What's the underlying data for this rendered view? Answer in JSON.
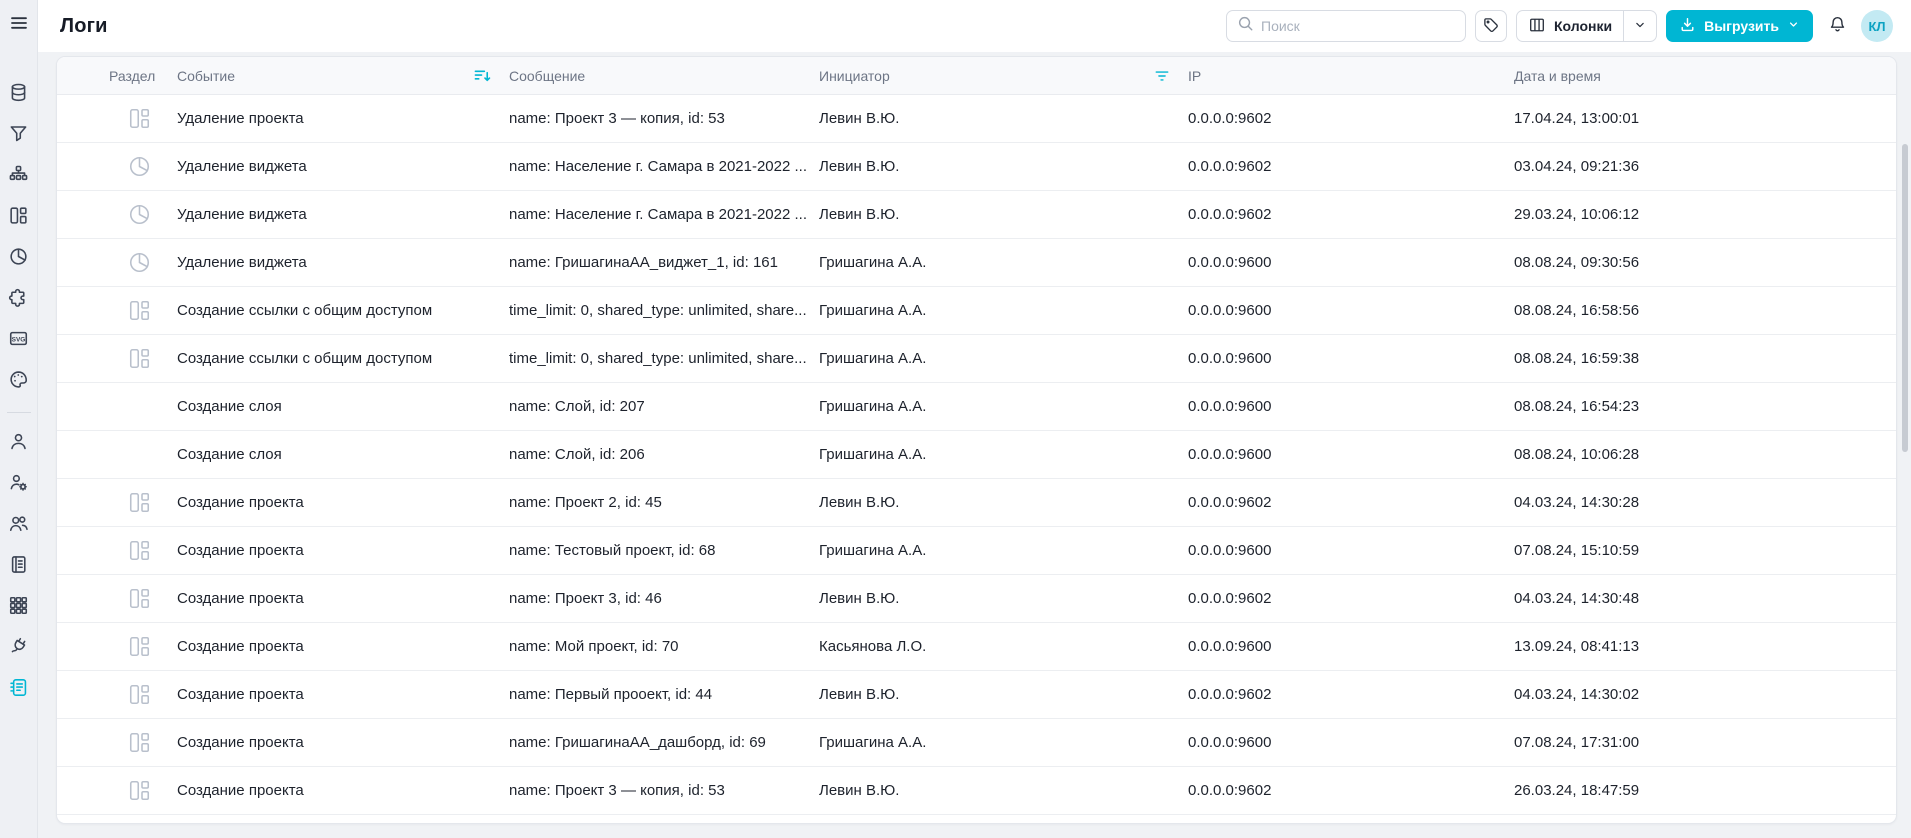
{
  "page": {
    "title": "Логи"
  },
  "topbar": {
    "search_placeholder": "Поиск",
    "columns_label": "Колонки",
    "export_label": "Выгрузить",
    "avatar_initials": "КЛ"
  },
  "sidebar": {
    "items": [
      {
        "icon": "database-icon",
        "active": false
      },
      {
        "icon": "filter-icon",
        "active": false
      },
      {
        "icon": "hierarchy-icon",
        "active": false
      },
      {
        "icon": "dashboard-icon",
        "active": false
      },
      {
        "icon": "pie-chart-icon",
        "active": false
      },
      {
        "icon": "puzzle-icon",
        "active": false
      },
      {
        "icon": "svg-icon",
        "active": false
      },
      {
        "icon": "palette-icon",
        "active": false
      },
      {
        "icon": "user-icon",
        "active": false
      },
      {
        "icon": "user-settings-icon",
        "active": false
      },
      {
        "icon": "users-icon",
        "active": false
      },
      {
        "icon": "book-icon",
        "active": false
      },
      {
        "icon": "grid-icon",
        "active": false
      },
      {
        "icon": "plug-icon",
        "active": false
      },
      {
        "icon": "logs-icon",
        "active": true
      }
    ]
  },
  "table": {
    "headers": {
      "section": "Раздел",
      "event": "Событие",
      "message": "Сообщение",
      "initiator": "Инициатор",
      "ip": "IP",
      "datetime": "Дата и время"
    },
    "rows": [
      {
        "icon": "dashboard-icon",
        "event": "Удаление проекта",
        "message": "name: Проект 3 — копия, id: 53",
        "initiator": "Левин В.Ю.",
        "ip": "0.0.0.0:9602",
        "datetime": "17.04.24, 13:00:01"
      },
      {
        "icon": "pie-chart-icon",
        "event": "Удаление виджета",
        "message": "name: Население г. Самара в 2021-2022 ...",
        "initiator": "Левин В.Ю.",
        "ip": "0.0.0.0:9602",
        "datetime": "03.04.24, 09:21:36"
      },
      {
        "icon": "pie-chart-icon",
        "event": "Удаление виджета",
        "message": "name: Население г. Самара в 2021-2022 ...",
        "initiator": "Левин В.Ю.",
        "ip": "0.0.0.0:9602",
        "datetime": "29.03.24, 10:06:12"
      },
      {
        "icon": "pie-chart-icon",
        "event": "Удаление виджета",
        "message": "name: ГришагинаАА_виджет_1, id: 161",
        "initiator": "Гришагина А.А.",
        "ip": "0.0.0.0:9600",
        "datetime": "08.08.24, 09:30:56"
      },
      {
        "icon": "dashboard-icon",
        "event": "Создание ссылки с общим доступом",
        "message": "time_limit: 0, shared_type: unlimited, share...",
        "initiator": "Гришагина А.А.",
        "ip": "0.0.0.0:9600",
        "datetime": "08.08.24, 16:58:56"
      },
      {
        "icon": "dashboard-icon",
        "event": "Создание ссылки с общим доступом",
        "message": "time_limit: 0, shared_type: unlimited, share...",
        "initiator": "Гришагина А.А.",
        "ip": "0.0.0.0:9600",
        "datetime": "08.08.24, 16:59:38"
      },
      {
        "icon": null,
        "event": "Создание слоя",
        "message": "name: Слой, id: 207",
        "initiator": "Гришагина А.А.",
        "ip": "0.0.0.0:9600",
        "datetime": "08.08.24, 16:54:23"
      },
      {
        "icon": null,
        "event": "Создание слоя",
        "message": "name: Слой, id: 206",
        "initiator": "Гришагина А.А.",
        "ip": "0.0.0.0:9600",
        "datetime": "08.08.24, 10:06:28"
      },
      {
        "icon": "dashboard-icon",
        "event": "Создание проекта",
        "message": "name: Проект 2, id: 45",
        "initiator": "Левин В.Ю.",
        "ip": "0.0.0.0:9602",
        "datetime": "04.03.24, 14:30:28"
      },
      {
        "icon": "dashboard-icon",
        "event": "Создание проекта",
        "message": "name: Тестовый проект, id: 68",
        "initiator": "Гришагина А.А.",
        "ip": "0.0.0.0:9600",
        "datetime": "07.08.24, 15:10:59"
      },
      {
        "icon": "dashboard-icon",
        "event": "Создание проекта",
        "message": "name: Проект 3, id: 46",
        "initiator": "Левин В.Ю.",
        "ip": "0.0.0.0:9602",
        "datetime": "04.03.24, 14:30:48"
      },
      {
        "icon": "dashboard-icon",
        "event": "Создание проекта",
        "message": "name: Мой проект, id: 70",
        "initiator": "Касьянова Л.О.",
        "ip": "0.0.0.0:9600",
        "datetime": "13.09.24, 08:41:13"
      },
      {
        "icon": "dashboard-icon",
        "event": "Создание проекта",
        "message": "name: Первый прооект, id: 44",
        "initiator": "Левин В.Ю.",
        "ip": "0.0.0.0:9602",
        "datetime": "04.03.24, 14:30:02"
      },
      {
        "icon": "dashboard-icon",
        "event": "Создание проекта",
        "message": "name: ГришагинаАА_дашборд, id: 69",
        "initiator": "Гришагина А.А.",
        "ip": "0.0.0.0:9600",
        "datetime": "07.08.24, 17:31:00"
      },
      {
        "icon": "dashboard-icon",
        "event": "Создание проекта",
        "message": "name: Проект 3 — копия, id: 53",
        "initiator": "Левин В.Ю.",
        "ip": "0.0.0.0:9602",
        "datetime": "26.03.24, 18:47:59"
      }
    ]
  },
  "colors": {
    "accent": "#00b6d3",
    "avatar_bg": "#c3eaf3",
    "avatar_text": "#0ba2c2",
    "row_icon": "#b9c0cc",
    "sidebar_icon": "#3c4454"
  }
}
